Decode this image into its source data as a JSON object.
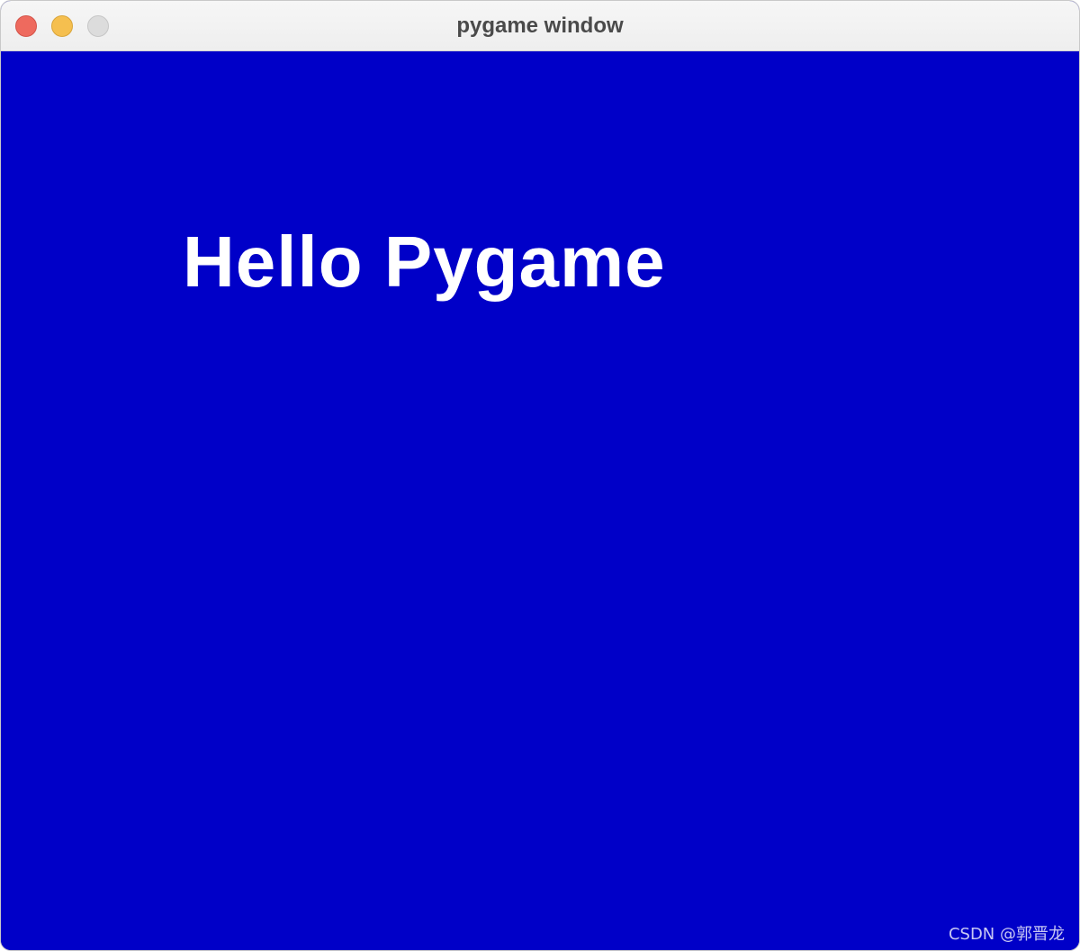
{
  "window": {
    "title": "pygame window",
    "controls": [
      {
        "name": "close",
        "color": "#ee6a5e"
      },
      {
        "name": "minimize",
        "color": "#f5bf4f"
      },
      {
        "name": "zoom",
        "color": "#dcdcdc"
      }
    ]
  },
  "canvas": {
    "background_color": "#0000c8",
    "text": "Hello Pygame",
    "text_color": "#ffffff"
  },
  "watermark": {
    "text": "CSDN @郭晋龙"
  }
}
